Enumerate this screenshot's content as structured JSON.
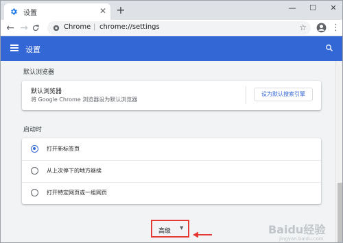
{
  "browser": {
    "tab": {
      "title": "设置",
      "favicon": "gear-icon",
      "close": "✕"
    },
    "new_tab": "+",
    "window_controls": {
      "minimize": "—",
      "maximize": "☐",
      "close": "✕"
    },
    "nav": {
      "back": "←",
      "forward": "→",
      "reload": "C"
    },
    "omnibox": {
      "origin": "Chrome",
      "separator": "|",
      "url": "chrome://settings",
      "bookmark": "☆"
    },
    "menu": "⋮"
  },
  "header": {
    "title": "设置",
    "menu_icon": "hamburger-icon",
    "search_icon": "search-icon"
  },
  "default_browser": {
    "section_title": "默认浏览器",
    "label": "默认浏览器",
    "description": "将 Google Chrome 浏览器设为默认浏览器",
    "button": "设为默认搜索引擎"
  },
  "startup": {
    "section_title": "启动时",
    "options": [
      {
        "label": "打开新标签页",
        "selected": true
      },
      {
        "label": "从上次停下的地方继续",
        "selected": false
      },
      {
        "label": "打开特定网页或一组网页",
        "selected": false
      }
    ]
  },
  "advanced": {
    "label": "高级",
    "caret": "▼"
  },
  "colors": {
    "header": "#3367d6",
    "accent": "#3367d6",
    "annotation": "#e53935"
  },
  "watermark": {
    "text": "Baidu经验",
    "subtext": "jingyan.baidu.com"
  }
}
